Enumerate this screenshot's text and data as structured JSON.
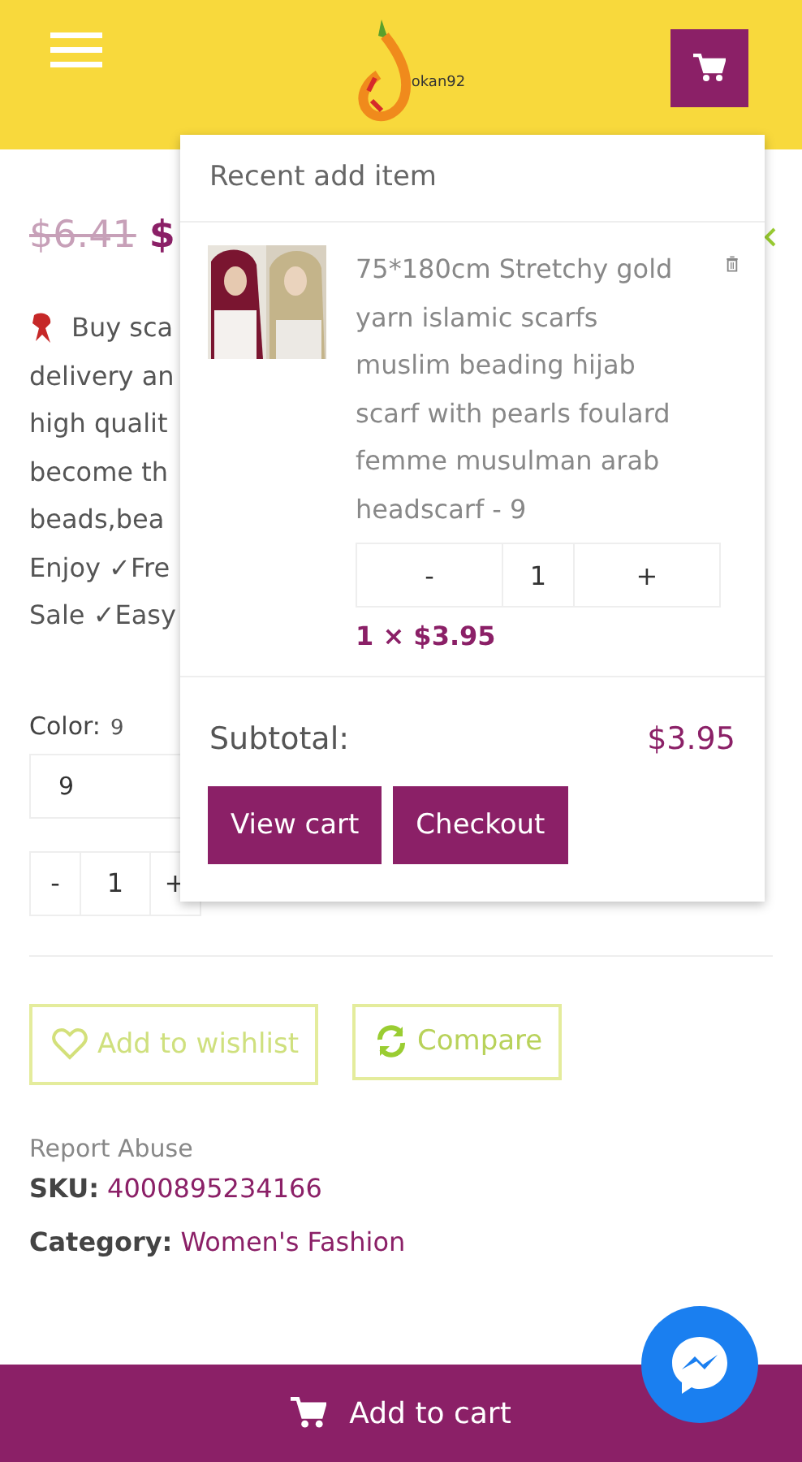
{
  "header": {
    "logo_text": "okan92"
  },
  "product": {
    "old_price": "$6.41",
    "price": "$",
    "description_lines": [
      "Buy sca",
      "delivery an",
      "high qualit",
      "become th",
      "beads,bea",
      "Enjoy ✓Fre",
      "Sale ✓Easy"
    ],
    "color_label": "Color:",
    "color_value": "9",
    "color_select": "9",
    "quantity": {
      "minus": "-",
      "value": "1",
      "plus": "+"
    },
    "wishlist": "Add to wishlist",
    "compare": "Compare",
    "report": "Report Abuse",
    "sku_label": "SKU:",
    "sku": "4000895234166",
    "category_label": "Category:",
    "category": "Women's Fashion"
  },
  "cart_popup": {
    "title": "Recent add item",
    "items": [
      {
        "name": "75*180cm Stretchy gold yarn islamic scarfs muslim beading hijab scarf with pearls foulard femme musulman arab headscarf - 9",
        "minus": "-",
        "quantity": "1",
        "plus": "+",
        "line_price": "1 × $3.95"
      }
    ],
    "subtotal_label": "Subtotal:",
    "subtotal": "$3.95",
    "buttons": [
      "View cart",
      "Checkout"
    ]
  },
  "bottom_bar": {
    "label": "Add to cart"
  }
}
